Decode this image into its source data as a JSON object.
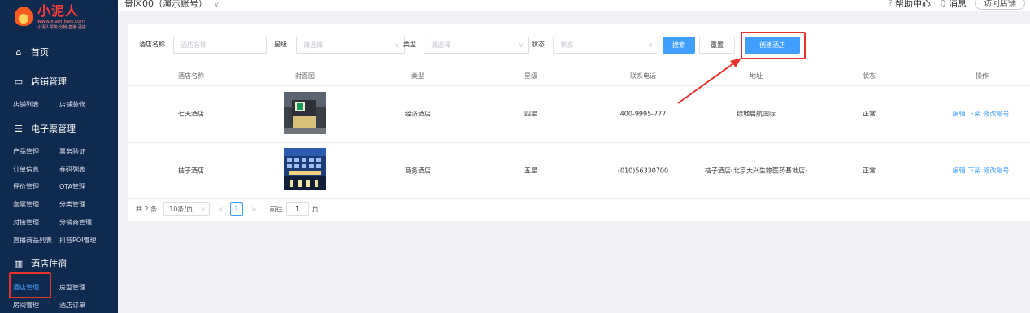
{
  "logo": {
    "title": "小泥人",
    "sub": "www.xiaoniren.com",
    "tag": "小泥人票务·分销·直播·酒店"
  },
  "header": {
    "title": "景区00（演示账号）",
    "help": "帮助中心",
    "messages": "消息",
    "visit": "访问店铺"
  },
  "sidebar": {
    "home": "首页",
    "shop": {
      "title": "店铺管理",
      "items": [
        "店铺列表",
        "店铺装修"
      ]
    },
    "ticket": {
      "title": "电子票管理",
      "rows": [
        [
          "产品管理",
          "票务验证"
        ],
        [
          "订单信息",
          "券码列表"
        ],
        [
          "评价管理",
          "OTA管理"
        ],
        [
          "套票管理",
          "分类管理"
        ],
        [
          "对接管理",
          "分销商管理"
        ],
        [
          "直播商品列表",
          "抖音POI管理"
        ]
      ]
    },
    "hotel": {
      "title": "酒店住宿",
      "rows": [
        [
          "酒店管理",
          "房型管理"
        ],
        [
          "房间管理",
          "酒店订单"
        ]
      ]
    }
  },
  "filters": {
    "name_label": "酒店名称",
    "name_placeholder": "酒店名称",
    "star_label": "星级",
    "star_placeholder": "请选择",
    "type_label": "类型",
    "type_placeholder": "请选择",
    "status_label": "状态",
    "status_placeholder": "状态",
    "search": "搜索",
    "reset": "重置",
    "create": "创建酒店"
  },
  "table": {
    "headers": [
      "酒店名称",
      "封面图",
      "类型",
      "星级",
      "联系电话",
      "地址",
      "状态",
      "操作"
    ],
    "rows": [
      {
        "name": "七天酒店",
        "type": "经济酒店",
        "star": "四星",
        "phone": "400-9995-777",
        "address": "绿地启航国际",
        "status": "正常",
        "ops": [
          "编辑",
          "下架",
          "修改账号"
        ]
      },
      {
        "name": "桔子酒店",
        "type": "商务酒店",
        "star": "五星",
        "phone": "(010)56330700",
        "address": "桔子酒店(北京大兴生物医药基地店)",
        "status": "正常",
        "ops": [
          "编辑",
          "下架",
          "修改账号"
        ]
      }
    ]
  },
  "pagination": {
    "total": "共 2 条",
    "page_size": "10条/页",
    "current": "1",
    "goto_prefix": "前往",
    "goto_value": "1",
    "goto_suffix": "页"
  },
  "colors": {
    "sidebar": "#0f2a4f",
    "primary": "#409eff",
    "highlight": "#e5322d"
  }
}
